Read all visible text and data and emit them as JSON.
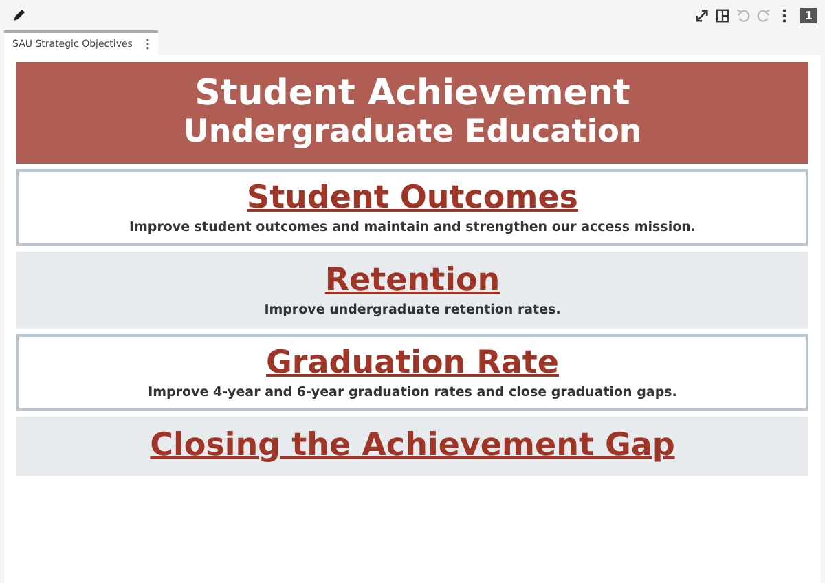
{
  "toolbar": {
    "tools": [
      {
        "kind": "expand",
        "disabled": false
      },
      {
        "kind": "layout",
        "disabled": false
      },
      {
        "kind": "undo",
        "disabled": true
      },
      {
        "kind": "redo",
        "disabled": true
      },
      {
        "kind": "more",
        "disabled": false
      }
    ],
    "badge": "1"
  },
  "tabs": [
    {
      "label": "SAU Strategic Objectives",
      "selected": true
    }
  ],
  "banner": {
    "title": "Student Achievement",
    "subtitle": "Undergraduate Education"
  },
  "objectives": [
    {
      "kind": "outlined",
      "title": "Student Outcomes",
      "description": "Improve student outcomes and maintain and strengthen our access mission."
    },
    {
      "kind": "shaded",
      "title": "Retention",
      "description": "Improve undergraduate retention rates."
    },
    {
      "kind": "outlined",
      "title": "Graduation Rate",
      "description": "Improve 4-year and 6-year graduation rates and close graduation gaps."
    },
    {
      "kind": "shaded",
      "title": "Closing the Achievement Gap"
    }
  ]
}
